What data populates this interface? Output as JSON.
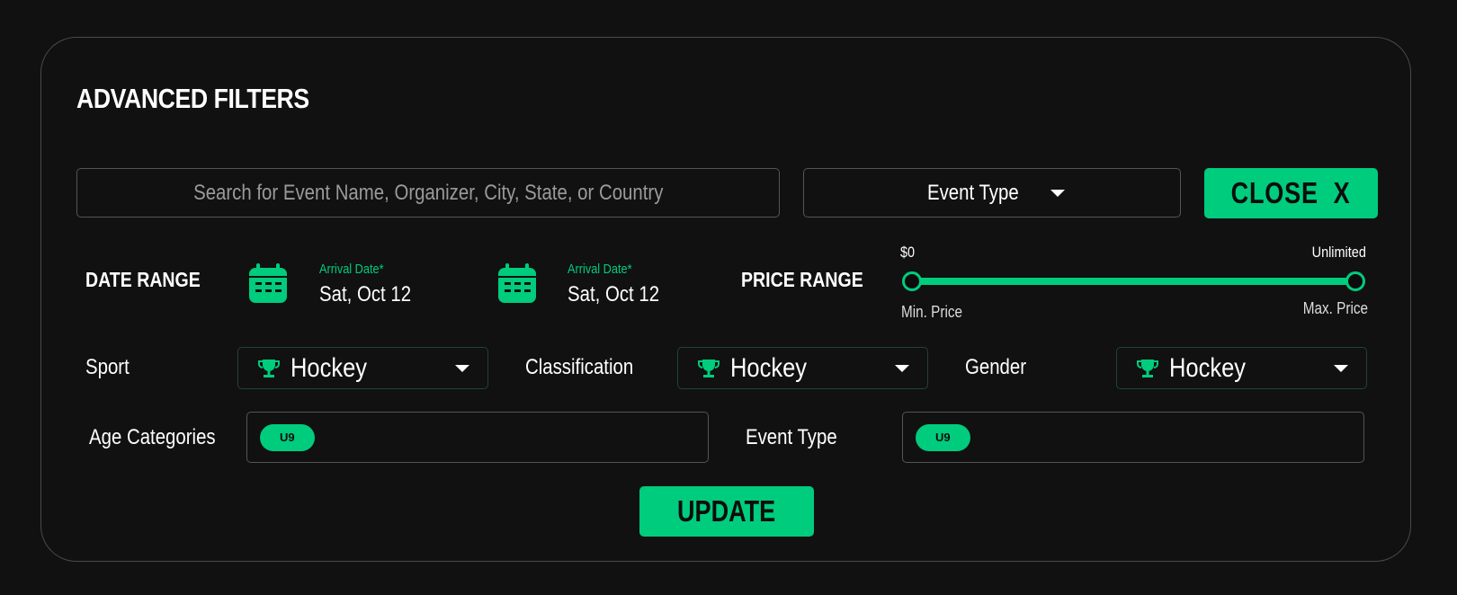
{
  "header": {
    "title": "ADVANCED FILTERS"
  },
  "search": {
    "placeholder": "Search for Event Name, Organizer, City, State, or Country"
  },
  "event_type_select": {
    "label": "Event Type"
  },
  "close_button": {
    "label": "CLOSE  X"
  },
  "date_range": {
    "label": "DATE RANGE",
    "start": {
      "caption": "Arrival Date*",
      "value": "Sat, Oct 12"
    },
    "end": {
      "caption": "Arrival Date*",
      "value": "Sat, Oct 12"
    }
  },
  "price_range": {
    "label": "PRICE RANGE",
    "min_value": "$0",
    "max_value": "Unlimited",
    "min_label": "Min. Price",
    "max_label": "Max. Price",
    "min_fraction": 0,
    "max_fraction": 1
  },
  "filters": {
    "sport": {
      "label": "Sport",
      "value": "Hockey"
    },
    "classification": {
      "label": "Classification",
      "value": "Hockey"
    },
    "gender": {
      "label": "Gender",
      "value": "Hockey"
    }
  },
  "age_categories": {
    "label": "Age Categories",
    "tags": [
      "U9"
    ]
  },
  "event_type_tags": {
    "label": "Event Type",
    "tags": [
      "U9"
    ]
  },
  "update_button": {
    "label": "UPDATE"
  },
  "colors": {
    "accent": "#00cc7d",
    "background": "#111111",
    "border": "#555555"
  },
  "icons": {
    "calendar": "calendar-icon",
    "trophy": "trophy-icon",
    "caret": "chevron-down-icon"
  }
}
